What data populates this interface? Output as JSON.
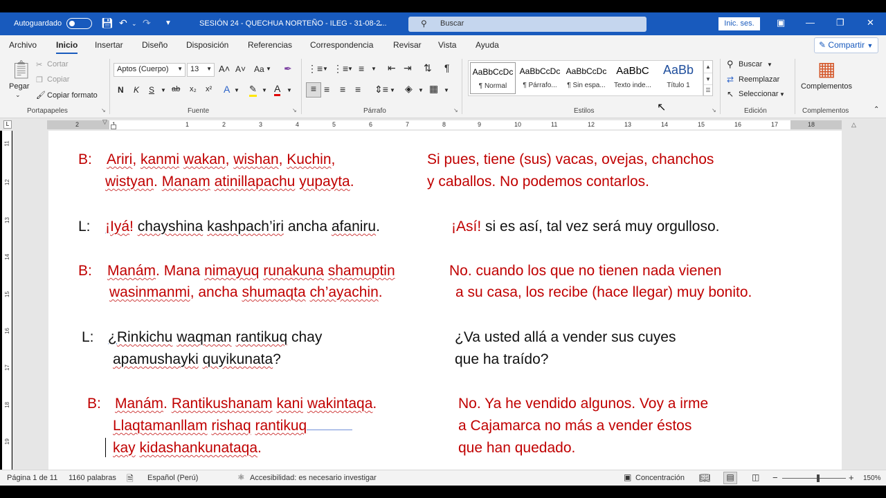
{
  "titlebar": {
    "autosave_label": "Autoguardado",
    "doc_title": "SESIÓN 24 - QUECHUA NORTEÑO - ILEG - 31-08-2...",
    "search_placeholder": "Buscar",
    "signin_label": "Inic. ses.",
    "save_icon": "save-icon",
    "undo_icon": "undo-icon",
    "redo_icon": "redo-icon"
  },
  "menu": {
    "tabs": [
      "Archivo",
      "Inicio",
      "Insertar",
      "Diseño",
      "Disposición",
      "Referencias",
      "Correspondencia",
      "Revisar",
      "Vista",
      "Ayuda"
    ],
    "share_label": "Compartir"
  },
  "ribbon": {
    "clipboard": {
      "paste": "Pegar",
      "cut": "Cortar",
      "copy": "Copiar",
      "format_painter": "Copiar formato",
      "label": "Portapapeles"
    },
    "font": {
      "name": "Aptos (Cuerpo)",
      "size": "13",
      "grow": "A˄",
      "shrink": "A˅",
      "case": "Aa",
      "bold": "N",
      "italic": "K",
      "underline": "S",
      "strike": "ab",
      "subscript": "x₂",
      "superscript": "x²",
      "label": "Fuente"
    },
    "paragraph": {
      "label": "Párrafo",
      "pilcrow": "¶"
    },
    "styles": {
      "label": "Estilos",
      "items": [
        {
          "preview": "AaBbCcDc",
          "name": "¶ Normal"
        },
        {
          "preview": "AaBbCcDc",
          "name": "¶ Párrafo..."
        },
        {
          "preview": "AaBbCcDc",
          "name": "¶ Sin espa..."
        },
        {
          "preview": "AaBbC",
          "name": "Texto inde..."
        },
        {
          "preview": "AaBb",
          "name": "Título 1"
        }
      ]
    },
    "editing": {
      "find": "Buscar",
      "replace": "Reemplazar",
      "select": "Seleccionar",
      "label": "Edición"
    },
    "addins": {
      "button": "Complementos",
      "label": "Complementos"
    }
  },
  "ruler": {
    "h_numbers": [
      "2",
      "1",
      "1",
      "2",
      "3",
      "4",
      "5",
      "6",
      "7",
      "8",
      "9",
      "10",
      "11",
      "12",
      "13",
      "14",
      "15",
      "16",
      "17",
      "18"
    ],
    "v_numbers": [
      "11",
      "12",
      "13",
      "14",
      "15",
      "16",
      "17",
      "18",
      "19"
    ]
  },
  "document": {
    "b1": {
      "speaker": "B:",
      "q1": [
        "Ariri",
        ", ",
        "kanmi",
        " ",
        "wakan",
        ", ",
        "wishan",
        ", ",
        "Kuchin",
        ","
      ],
      "q2": [
        "wistyan",
        ". ",
        "Manam",
        " ",
        "atinillapachu",
        " ",
        "yupayta",
        "."
      ],
      "es1": "Si pues, tiene (sus) vacas, ovejas, chanchos",
      "es2": "y caballos. No podemos contarlos."
    },
    "l1": {
      "speaker": "L:",
      "q1": [
        "¡",
        "Iyá",
        "! ",
        "chayshina",
        " ",
        "kashpach’iri",
        " ancha ",
        "afaniru",
        "."
      ],
      "es1_a": "¡Así",
      "es1_b": "!",
      "es1_c": " si es así, tal vez será muy orgulloso."
    },
    "b2": {
      "speaker": "B:",
      "q1": [
        "Manám",
        ". Mana ",
        "nimayuq",
        " ",
        "runakuna",
        " ",
        "shamuptin"
      ],
      "q2": [
        "wasinmanmi",
        ", ancha ",
        "shumaqta",
        " ",
        "ch’ayachin",
        "."
      ],
      "es1": "No. cuando los que no tienen nada vienen",
      "es2": "a su casa, los recibe (hace llegar) muy bonito."
    },
    "l2": {
      "speaker": "L:",
      "q1": [
        "¿",
        "Rinkichu",
        " ",
        "waqman",
        " ",
        "rantikuq",
        "  chay"
      ],
      "q2": [
        "apamushayki",
        " ",
        "quyikunata",
        "?"
      ],
      "es1": "¿Va usted allá a vender sus cuyes",
      "es2": "que ha traído?"
    },
    "b3": {
      "speaker": "B:",
      "q1": [
        "Manám",
        ". ",
        "Rantikushanam",
        " ",
        "kani",
        " ",
        "wakintaqa",
        "."
      ],
      "q2": [
        "Llaqtamanllam",
        " ",
        "rishaq",
        " ",
        "rantikuq"
      ],
      "q3": [
        "kay",
        " ",
        "kidashankunataqa",
        "."
      ],
      "es1": "No. Ya he vendido algunos. Voy a irme",
      "es2": "a Cajamarca no más a vender éstos",
      "es3": "que han quedado."
    }
  },
  "status": {
    "page": "Página 1 de 11",
    "words": "1160 palabras",
    "language": "Español (Perú)",
    "accessibility": "Accesibilidad: es necesario investigar",
    "focus": "Concentración",
    "zoom_minus": "−",
    "zoom_plus": "+",
    "zoom": "150%"
  },
  "colors": {
    "title_blue": "#185abd",
    "dialog_red": "#c00000"
  }
}
